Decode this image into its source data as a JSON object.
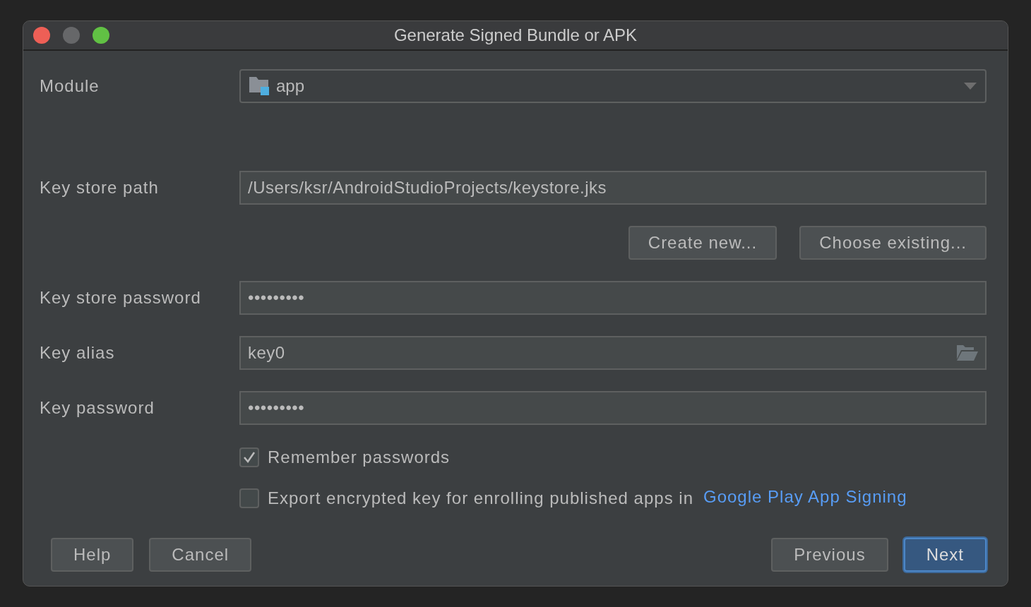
{
  "window": {
    "title": "Generate Signed Bundle or APK"
  },
  "module": {
    "label": "Module",
    "value": "app"
  },
  "key_store_path": {
    "label": "Key store path",
    "value": "/Users/ksr/AndroidStudioProjects/keystore.jks"
  },
  "key_store_buttons": [
    "Create new...",
    "Choose existing..."
  ],
  "key_store_password": {
    "label": "Key store password",
    "value": "•••••••••"
  },
  "key_alias": {
    "label": "Key alias",
    "value": "key0"
  },
  "key_password": {
    "label": "Key password",
    "value": "•••••••••"
  },
  "options": [
    {
      "label": "Remember passwords",
      "checked": true
    },
    {
      "label": "Export encrypted key for enrolling published apps in",
      "checked": false,
      "link": "Google Play App Signing"
    }
  ],
  "left_buttons": [
    {
      "label": "Help",
      "default": false
    },
    {
      "label": "Cancel",
      "default": false
    }
  ],
  "right_buttons": [
    {
      "label": "Previous",
      "default": false
    },
    {
      "label": "Next",
      "default": true
    }
  ]
}
